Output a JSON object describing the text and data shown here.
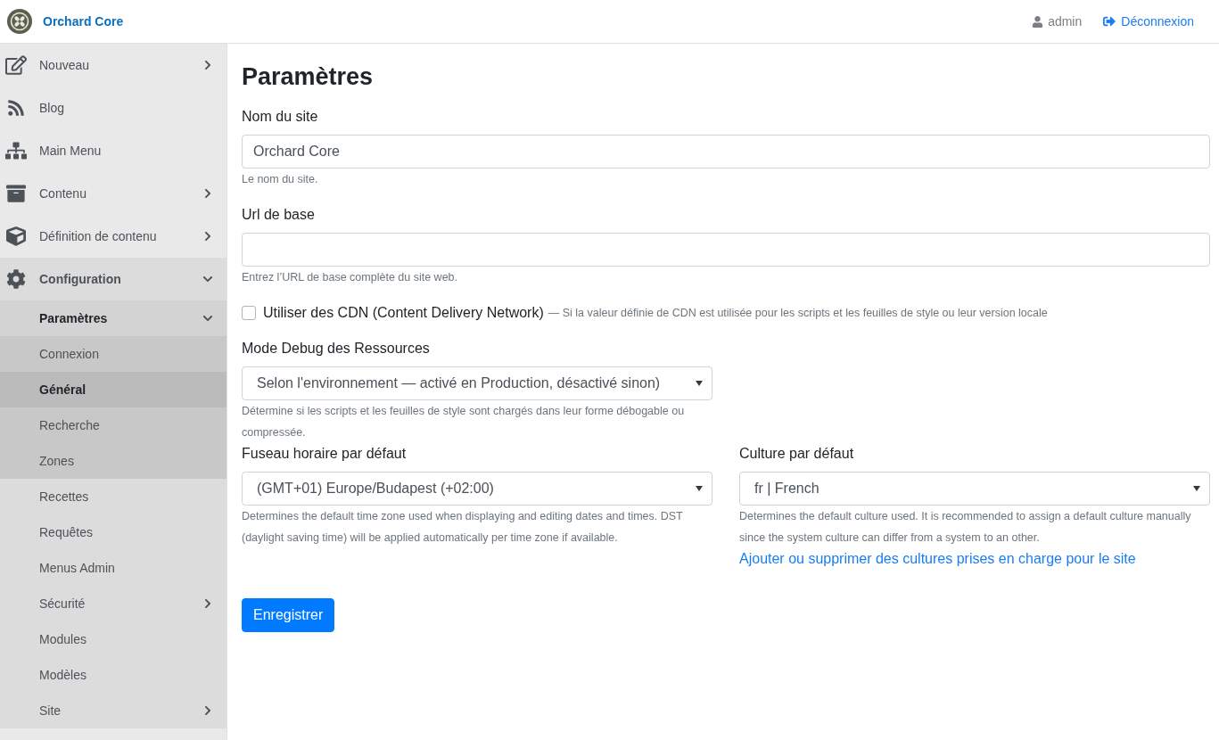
{
  "header": {
    "brand": "Orchard Core",
    "user": "admin",
    "logout": "Déconnexion"
  },
  "sidebar": {
    "items": [
      {
        "label": "Nouveau",
        "kind": "group",
        "expanded": false,
        "selected": false
      },
      {
        "label": "Blog",
        "kind": "link",
        "selected": false
      },
      {
        "label": "Main Menu",
        "kind": "link",
        "selected": false
      },
      {
        "label": "Contenu",
        "kind": "group",
        "expanded": false,
        "selected": false
      },
      {
        "label": "Définition de contenu",
        "kind": "group",
        "expanded": false,
        "selected": false
      },
      {
        "label": "Configuration",
        "kind": "group",
        "expanded": true,
        "selected": false,
        "children": [
          {
            "label": "Paramètres",
            "kind": "group",
            "expanded": true,
            "selected": false,
            "children": [
              {
                "label": "Connexion",
                "kind": "link",
                "selected": false
              },
              {
                "label": "Général",
                "kind": "link",
                "selected": true
              },
              {
                "label": "Recherche",
                "kind": "link",
                "selected": false
              },
              {
                "label": "Zones",
                "kind": "link",
                "selected": false
              }
            ]
          },
          {
            "label": "Recettes",
            "kind": "link",
            "selected": false
          },
          {
            "label": "Requêtes",
            "kind": "link",
            "selected": false
          },
          {
            "label": "Menus Admin",
            "kind": "link",
            "selected": false
          },
          {
            "label": "Sécurité",
            "kind": "group",
            "expanded": false,
            "selected": false
          },
          {
            "label": "Modules",
            "kind": "link",
            "selected": false
          },
          {
            "label": "Modèles",
            "kind": "link",
            "selected": false
          },
          {
            "label": "Site",
            "kind": "group",
            "expanded": false,
            "selected": false
          }
        ]
      }
    ]
  },
  "form": {
    "title": "Paramètres",
    "site_name": {
      "label": "Nom du site",
      "value": "Orchard Core",
      "help": "Le nom du site."
    },
    "base_url": {
      "label": "Url de base",
      "help": "Entrez l’URL de base complète du site web."
    },
    "cdn": {
      "label": "Utiliser des CDN (Content Delivery Network)",
      "checked": false,
      "hint": "— Si la valeur définie de CDN est utilisée pour les scripts et les feuilles de style ou leur version locale"
    },
    "debug_mode": {
      "label": "Mode Debug des Ressources",
      "value": "Selon l'environnement — activé en Production, désactivé sinon)",
      "help": "Détermine si les scripts et les feuilles de style sont chargés dans leur forme débogable ou compressée."
    },
    "time_zone": {
      "label": "Fuseau horaire par défaut",
      "value": "(GMT+01) Europe/Budapest (+02:00)",
      "help": "Determines the default time zone used when displaying and editing dates and times. DST (daylight saving time) will be applied automatically per time zone if available."
    },
    "culture": {
      "label": "Culture par défaut",
      "value": "fr | French",
      "help": "Determines the default culture used. It is recommended to assign a default culture manually since the system culture can differ from a system to an other.",
      "link": "Ajouter ou supprimer des cultures prises en charge pour le site"
    },
    "save": "Enregistrer"
  }
}
